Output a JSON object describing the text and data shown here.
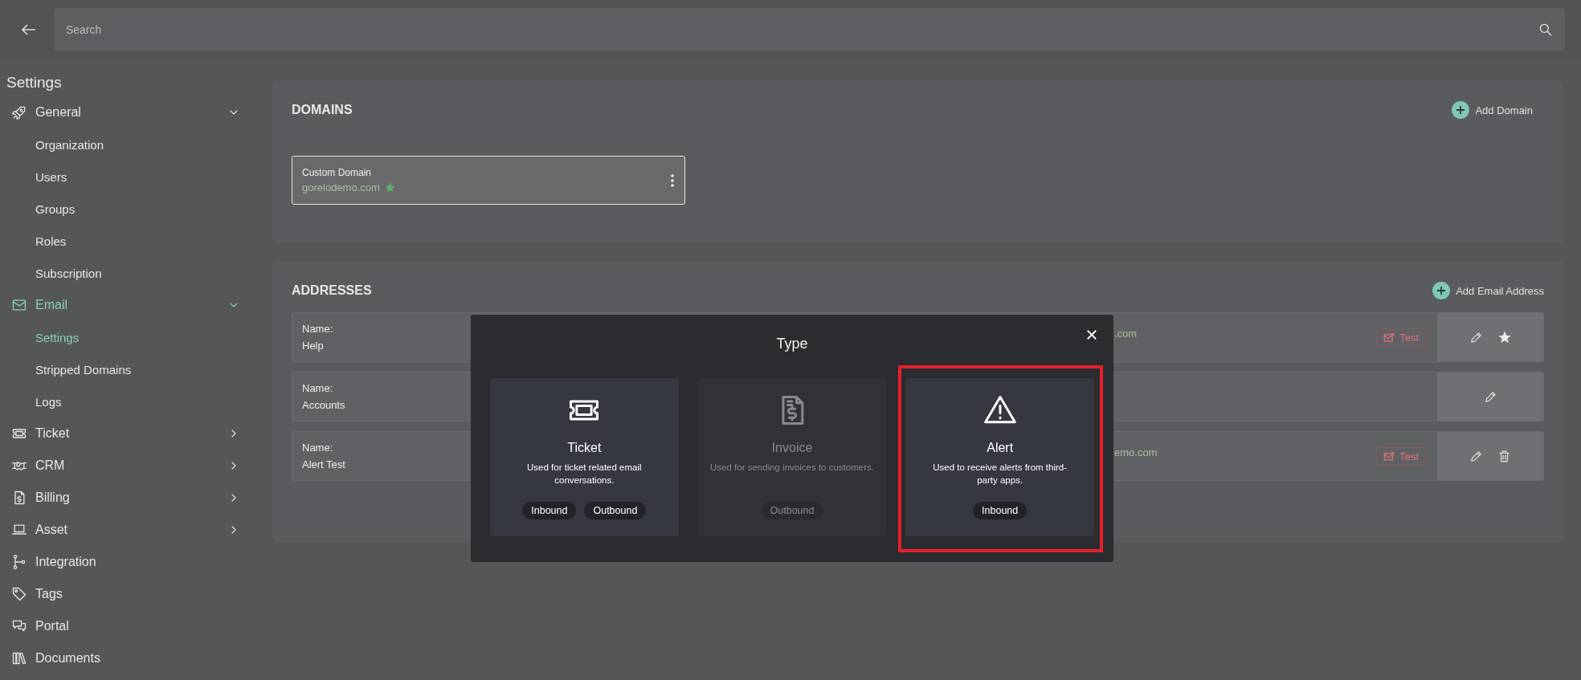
{
  "search": {
    "placeholder": "Search"
  },
  "sidebar": {
    "title": "Settings",
    "items": [
      {
        "label": "General",
        "expanded": true,
        "selected": false,
        "children": [
          {
            "label": "Organization",
            "selected": false
          },
          {
            "label": "Users",
            "selected": false
          },
          {
            "label": "Groups",
            "selected": false
          },
          {
            "label": "Roles",
            "selected": false
          },
          {
            "label": "Subscription",
            "selected": false
          }
        ]
      },
      {
        "label": "Email",
        "expanded": true,
        "selected": true,
        "children": [
          {
            "label": "Settings",
            "selected": true
          },
          {
            "label": "Stripped Domains",
            "selected": false
          },
          {
            "label": "Logs",
            "selected": false
          }
        ]
      },
      {
        "label": "Ticket",
        "expanded": false,
        "selected": false
      },
      {
        "label": "CRM",
        "expanded": false,
        "selected": false
      },
      {
        "label": "Billing",
        "expanded": false,
        "selected": false
      },
      {
        "label": "Asset",
        "expanded": false,
        "selected": false
      },
      {
        "label": "Integration",
        "selected": false
      },
      {
        "label": "Tags",
        "selected": false
      },
      {
        "label": "Portal",
        "selected": false
      },
      {
        "label": "Documents",
        "selected": false
      }
    ]
  },
  "domains": {
    "title": "DOMAINS",
    "add_button": "Add Domain",
    "items": [
      {
        "label": "Custom Domain",
        "domain": "gorelodemo.com",
        "primary": true
      }
    ]
  },
  "addresses": {
    "title": "ADDRESSES",
    "add_button": "Add Email Address",
    "rows": [
      {
        "name_label": "Name:",
        "name": "Help",
        "visible_fragment": ".com",
        "test_button": "Test",
        "actions": [
          {
            "kind": "edit"
          },
          {
            "kind": "star"
          }
        ]
      },
      {
        "name_label": "Name:",
        "name": "Accounts",
        "actions": [
          {
            "kind": "edit"
          }
        ]
      },
      {
        "name_label": "Name:",
        "name": "Alert Test",
        "visible_fragment": "emo.com",
        "test_button": "Test",
        "actions": [
          {
            "kind": "edit"
          },
          {
            "kind": "delete"
          }
        ]
      }
    ]
  },
  "modal": {
    "title": "Type",
    "cards": [
      {
        "kind": "ticket",
        "title": "Ticket",
        "description": "Used for ticket related email conversations.",
        "tags": [
          "Inbound",
          "Outbound"
        ],
        "disabled": false,
        "selected": false
      },
      {
        "kind": "invoice",
        "title": "Invoice",
        "description": "Used for sending invoices to customers.",
        "tags": [
          "Outbound"
        ],
        "disabled": true,
        "selected": false
      },
      {
        "kind": "alert",
        "title": "Alert",
        "description": "Used to receive alerts from third-party apps.",
        "tags": [
          "Inbound"
        ],
        "disabled": false,
        "selected": true
      }
    ]
  }
}
